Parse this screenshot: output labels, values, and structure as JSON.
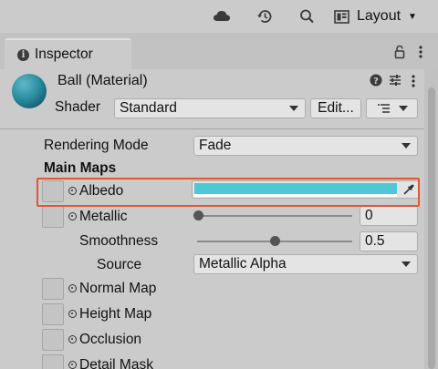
{
  "toolbar": {
    "cloud_icon": "cloud-icon",
    "history_icon": "history-icon",
    "search_icon": "search-icon",
    "layout_label": "Layout"
  },
  "tab": {
    "label": "Inspector"
  },
  "material": {
    "title": "Ball (Material)",
    "shader_label": "Shader",
    "shader_value": "Standard",
    "edit_label": "Edit..."
  },
  "props": {
    "rendering_mode_label": "Rendering Mode",
    "rendering_mode_value": "Fade",
    "main_maps_label": "Main Maps",
    "albedo_label": "Albedo",
    "albedo_color": "#4dc8d4",
    "metallic_label": "Metallic",
    "metallic_value": "0",
    "metallic_level": 0,
    "smoothness_label": "Smoothness",
    "smoothness_value": "0.5",
    "smoothness_level": 0.5,
    "source_label": "Source",
    "source_value": "Metallic Alpha",
    "normal_map_label": "Normal Map",
    "height_map_label": "Height Map",
    "occlusion_label": "Occlusion",
    "detail_mask_label": "Detail Mask"
  },
  "colors": {
    "highlight": "#e2572c"
  }
}
